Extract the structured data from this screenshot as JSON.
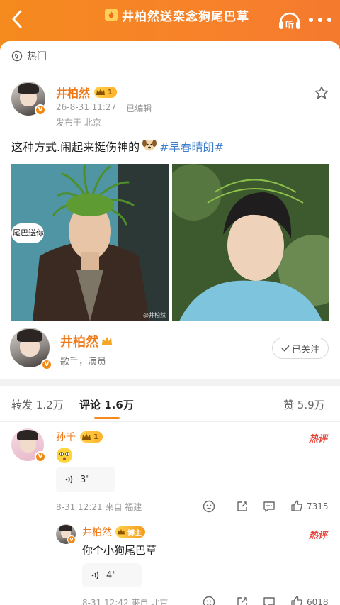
{
  "header": {
    "title": "井柏然送栾念狗尾巴草"
  },
  "hot_label": "热门",
  "post": {
    "author": "井柏然",
    "level": "1",
    "timestamp": "26-8-31 11:27",
    "edited": "已编辑",
    "location": "发布于 北京",
    "text": "这种方式.闹起来挺伤神的",
    "hashtag": "#早春晴朗#",
    "photo_caption": "尾巴送你",
    "photo_watermark": "@井柏然"
  },
  "profile": {
    "name": "井柏然",
    "title": "歌手，演员",
    "follow_label": "已关注"
  },
  "tabs": {
    "repost": "转发",
    "repost_count": "1.2万",
    "comment": "评论",
    "comment_count": "1.6万",
    "like": "赞",
    "like_count": "5.9万"
  },
  "comments": [
    {
      "user": "孙千",
      "level": "1",
      "hot": "热评",
      "voice_len": "3\"",
      "meta": "8-31 12:21 来自 福建",
      "likes": "7315"
    },
    {
      "user": "井柏然",
      "badge": "博主",
      "hot": "热评",
      "text": "你个小狗尾巴草",
      "voice_len": "4\"",
      "meta": "8-31 12:42 来自 北京",
      "likes": "6018"
    }
  ]
}
